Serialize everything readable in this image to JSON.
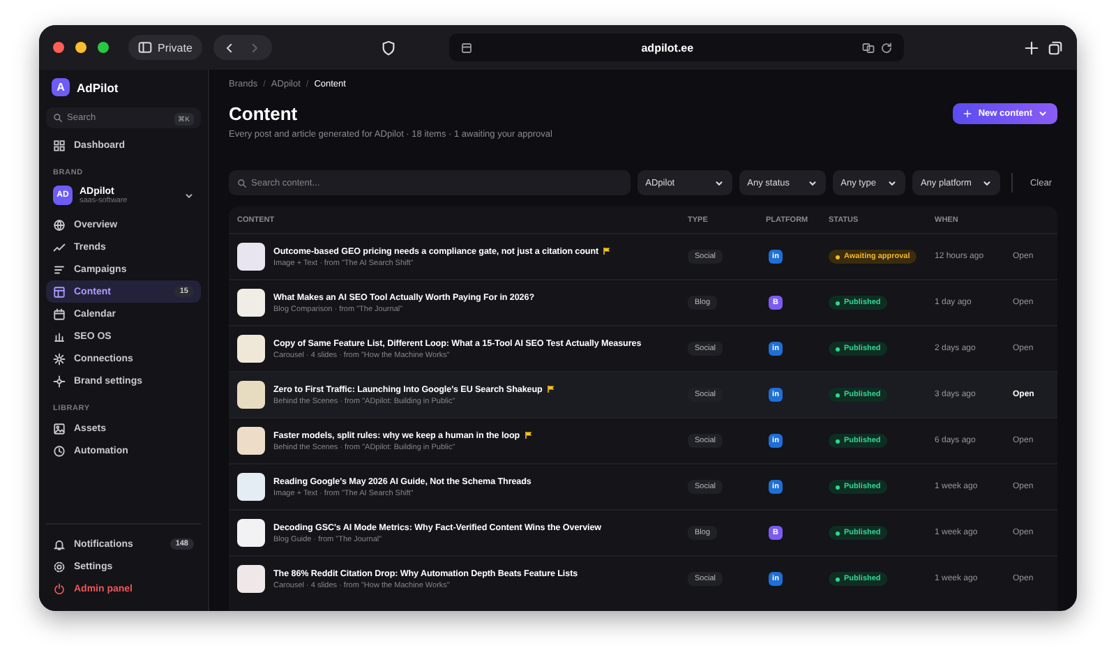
{
  "browser": {
    "tab_label": "Private",
    "url": "adpilot.ee"
  },
  "sidebar": {
    "logo_letter": "A",
    "app_name": "AdPilot",
    "search_placeholder": "Search",
    "search_shortcut": "⌘K",
    "top_nav": [
      {
        "label": "Dashboard",
        "selected": false
      }
    ],
    "brand_section": "BRAND",
    "brand": {
      "initials": "AD",
      "name": "ADpilot",
      "slug": "saas-software"
    },
    "brand_nav": [
      {
        "label": "Overview",
        "selected": false
      },
      {
        "label": "Trends",
        "selected": false
      },
      {
        "label": "Campaigns",
        "selected": false
      },
      {
        "label": "Content",
        "selected": true,
        "count": "15"
      },
      {
        "label": "Calendar",
        "selected": false
      },
      {
        "label": "SEO OS",
        "selected": false
      },
      {
        "label": "Connections",
        "selected": false
      },
      {
        "label": "Brand settings",
        "selected": false
      }
    ],
    "library_section": "LIBRARY",
    "library_nav": [
      {
        "label": "Assets",
        "selected": false
      },
      {
        "label": "Automation",
        "selected": false
      }
    ],
    "footer_nav": [
      {
        "label": "Notifications",
        "kind": "normal",
        "count": "148"
      },
      {
        "label": "Settings",
        "kind": "normal"
      },
      {
        "label": "Admin panel",
        "kind": "danger"
      }
    ]
  },
  "main": {
    "breadcrumbs": [
      "Brands",
      "ADpilot",
      "Content"
    ],
    "breadcrumb_separator": "/",
    "title": "Content",
    "subtitle": "Every post and article generated for ADpilot · 18 items · 1 awaiting your approval",
    "new_button": "New content",
    "search_placeholder": "Search content...",
    "filters": [
      "ADpilot",
      "Any status",
      "Any type",
      "Any platform"
    ],
    "clear": "Clear"
  },
  "table": {
    "columns": [
      "CONTENT",
      "TYPE",
      "PLATFORM",
      "STATUS",
      "WHEN"
    ],
    "rows": [
      {
        "title": "Outcome-based GEO pricing needs a compliance gate, not just a citation count",
        "meta": "Image + Text · from \"The AI Search Shift\"",
        "flagged": true,
        "type": "Social",
        "platform": {
          "kind": "linkedin",
          "label": "in"
        },
        "status": {
          "kind": "awaiting",
          "label": "Awaiting approval"
        },
        "when": "12 hours ago",
        "action": "Open",
        "selected": false
      },
      {
        "title": "What Makes an AI SEO Tool Actually Worth Paying For in 2026?",
        "meta": "Blog Comparison · from \"The Journal\"",
        "flagged": false,
        "type": "Blog",
        "platform": {
          "kind": "blog",
          "label": "B"
        },
        "status": {
          "kind": "published",
          "label": "Published"
        },
        "when": "1 day ago",
        "action": "Open",
        "selected": false
      },
      {
        "title": "Copy of Same Feature List, Different Loop: What a 15-Tool AI SEO Test Actually Measures",
        "meta": "Carousel · 4 slides · from \"How the Machine Works\"",
        "flagged": false,
        "type": "Social",
        "platform": {
          "kind": "linkedin",
          "label": "in"
        },
        "status": {
          "kind": "published",
          "label": "Published"
        },
        "when": "2 days ago",
        "action": "Open",
        "selected": false
      },
      {
        "title": "Zero to First Traffic: Launching Into Google's EU Search Shakeup",
        "meta": "Behind the Scenes · from \"ADpilot: Building in Public\"",
        "flagged": true,
        "type": "Social",
        "platform": {
          "kind": "linkedin",
          "label": "in"
        },
        "status": {
          "kind": "published",
          "label": "Published"
        },
        "when": "3 days ago",
        "action": "Open",
        "selected": true
      },
      {
        "title": "Faster models, split rules: why we keep a human in the loop",
        "meta": "Behind the Scenes · from \"ADpilot: Building in Public\"",
        "flagged": true,
        "type": "Social",
        "platform": {
          "kind": "linkedin",
          "label": "in"
        },
        "status": {
          "kind": "published",
          "label": "Published"
        },
        "when": "6 days ago",
        "action": "Open",
        "selected": false
      },
      {
        "title": "Reading Google's May 2026 AI Guide, Not the Schema Threads",
        "meta": "Image + Text · from \"The AI Search Shift\"",
        "flagged": false,
        "type": "Social",
        "platform": {
          "kind": "linkedin",
          "label": "in"
        },
        "status": {
          "kind": "published",
          "label": "Published"
        },
        "when": "1 week ago",
        "action": "Open",
        "selected": false
      },
      {
        "title": "Decoding GSC's AI Mode Metrics: Why Fact-Verified Content Wins the Overview",
        "meta": "Blog Guide · from \"The Journal\"",
        "flagged": false,
        "type": "Blog",
        "platform": {
          "kind": "blog",
          "label": "B"
        },
        "status": {
          "kind": "published",
          "label": "Published"
        },
        "when": "1 week ago",
        "action": "Open",
        "selected": false
      },
      {
        "title": "The 86% Reddit Citation Drop: Why Automation Depth Beats Feature Lists",
        "meta": "Carousel · 4 slides · from \"How the Machine Works\"",
        "flagged": false,
        "type": "Social",
        "platform": {
          "kind": "linkedin",
          "label": "in"
        },
        "status": {
          "kind": "published",
          "label": "Published"
        },
        "when": "1 week ago",
        "action": "Open",
        "selected": false
      }
    ]
  }
}
